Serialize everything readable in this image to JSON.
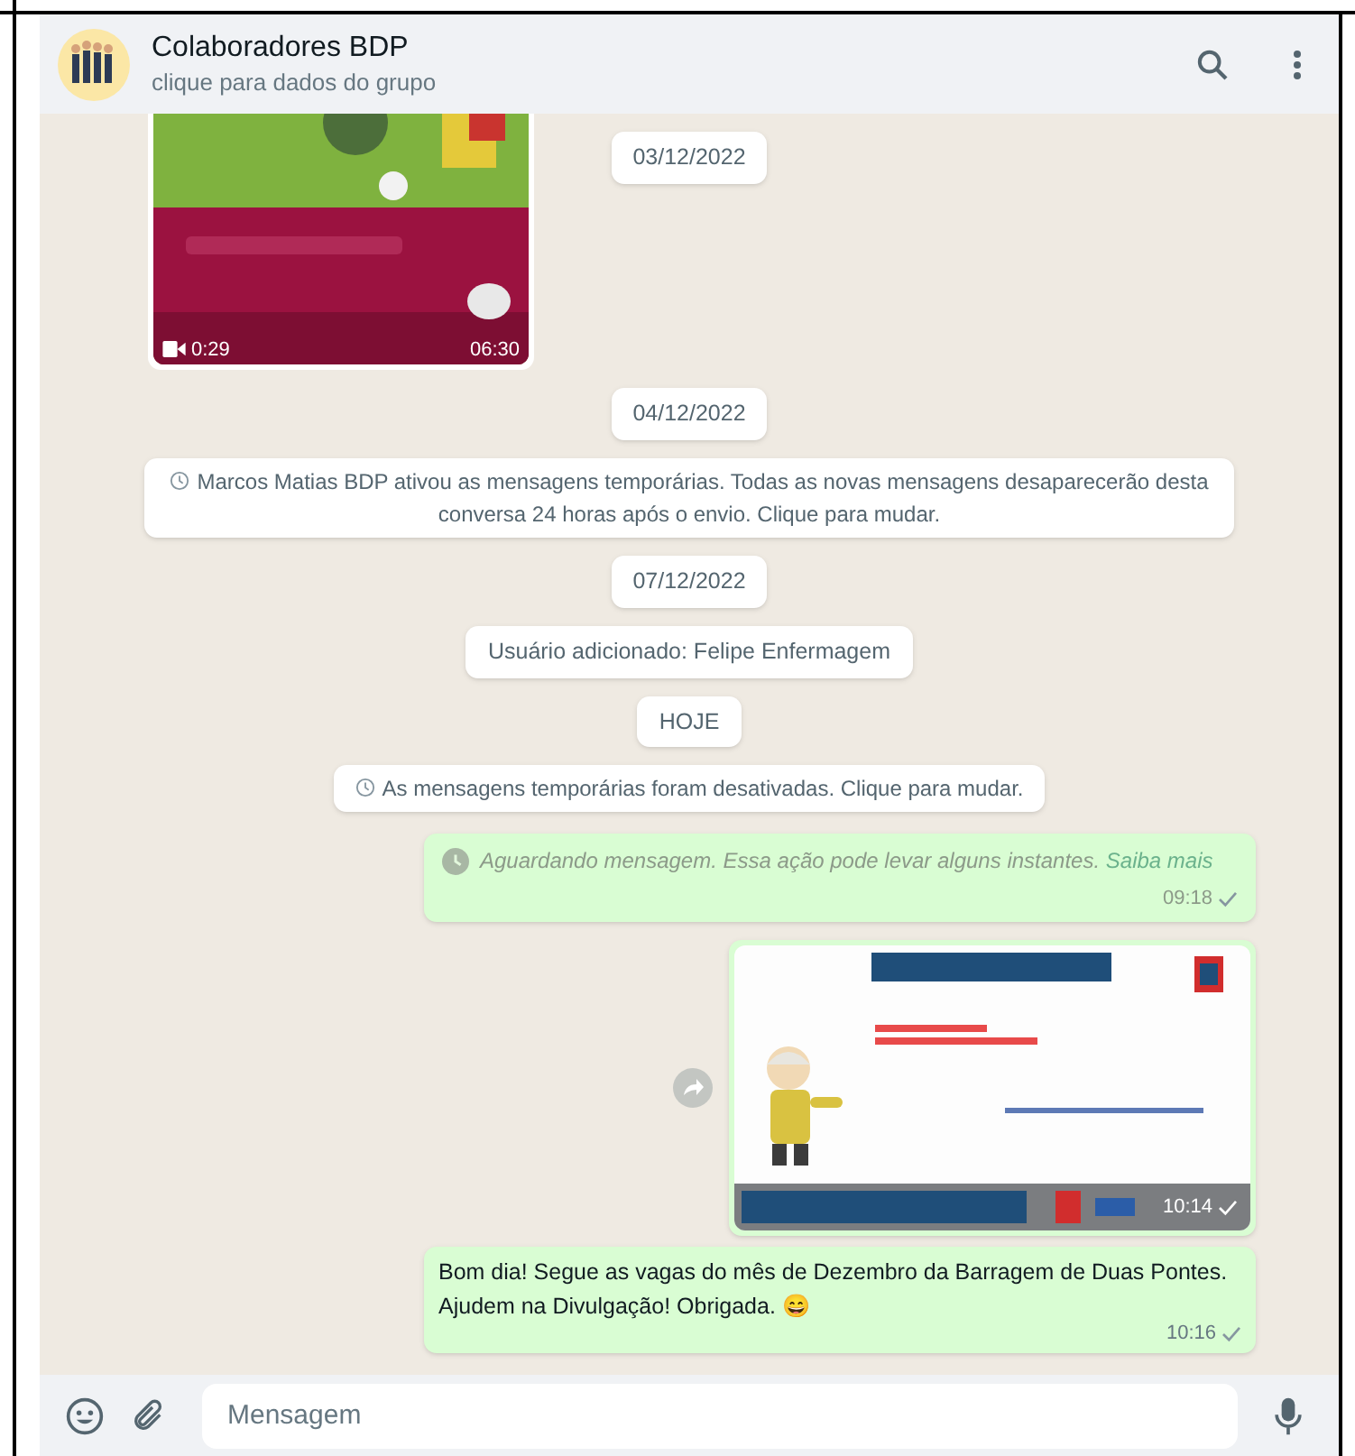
{
  "header": {
    "title": "Colaboradores BDP",
    "subtitle": "clique para dados do grupo"
  },
  "messages": [
    {
      "kind": "video",
      "duration": "0:29",
      "time": "06:30"
    },
    {
      "kind": "date",
      "text": "03/12/2022"
    },
    {
      "kind": "date",
      "text": "04/12/2022"
    },
    {
      "kind": "timer_notice",
      "text": "Marcos Matias BDP ativou as mensagens temporárias. Todas as novas mensagens desaparecerão desta conversa 24 horas após o envio. Clique para mudar."
    },
    {
      "kind": "date",
      "text": "07/12/2022"
    },
    {
      "kind": "notice",
      "text": "Usuário adicionado: Felipe Enfermagem"
    },
    {
      "kind": "date",
      "text": "HOJE"
    },
    {
      "kind": "timer_notice",
      "text": "As mensagens temporárias foram desativadas. Clique para mudar."
    },
    {
      "kind": "waiting",
      "text": "Aguardando mensagem. Essa ação pode levar alguns instantes.",
      "link": "Saiba mais",
      "time": "09:18",
      "read": false
    },
    {
      "time": "10:14",
      "read": false
    },
    {
      "kind": "text",
      "text": "Bom dia! Segue as vagas do mês de Dezembro da Barragem de Duas Pontes. Ajudem na Divulgação! Obrigada. 😄",
      "time": "10:16",
      "read": false
    }
  ],
  "composer": {
    "placeholder": "Mensagem"
  }
}
